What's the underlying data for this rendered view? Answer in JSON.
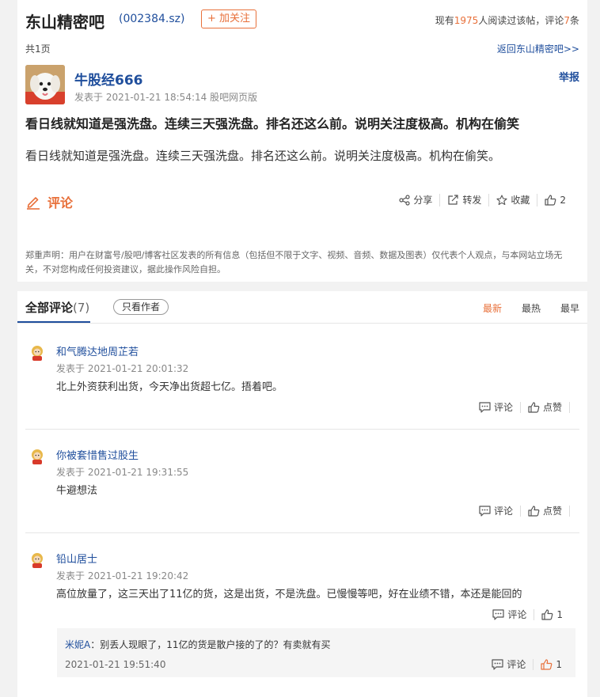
{
  "topbar": {
    "title": "东山精密吧",
    "stock_code": "(002384.sz)",
    "follow_label": "+ 加关注",
    "stats_prefix": "现有",
    "readers": "1975",
    "stats_mid": "人阅读过该帖，评论",
    "comment_count": "7",
    "stats_suffix": "条"
  },
  "nav": {
    "page_count": "共1页",
    "back_link": "返回东山精密吧>>"
  },
  "post": {
    "author": "牛股经666",
    "meta": "发表于 2021-01-21 18:54:14 股吧网页版",
    "report_label": "举报",
    "title": "看日线就知道是强洗盘。连续三天强洗盘。排名还这么前。说明关注度极高。机构在偷笑",
    "body": "看日线就知道是强洗盘。连续三天强洗盘。排名还这么前。说明关注度极高。机构在偷笑。",
    "comment_label": "评论",
    "actions": {
      "share": "分享",
      "repost": "转发",
      "collect": "收藏",
      "likes": "2"
    }
  },
  "disclaimer": "郑重声明：用户在财富号/股吧/博客社区发表的所有信息（包括但不限于文字、视频、音频、数据及图表）仅代表个人观点，与本网站立场无关，不对您构成任何投资建议，据此操作风险自担。",
  "comments_header": {
    "all_label": "全部评论",
    "count": "(7)",
    "author_only": "只看作者",
    "sort_latest": "最新",
    "sort_hot": "最热",
    "sort_earliest": "最早"
  },
  "comments": [
    {
      "name": "和气腾达地周芷若",
      "time": "发表于 2021-01-21 20:01:32",
      "text": "北上外资获利出货，今天净出货超七亿。捂着吧。",
      "reply_label": "评论",
      "like_label": "点赞"
    },
    {
      "name": "你被套惜售过股生",
      "time": "发表于 2021-01-21 19:31:55",
      "text": "牛避想法",
      "reply_label": "评论",
      "like_label": "点赞"
    },
    {
      "name": "铅山居士",
      "time": "发表于 2021-01-21 19:20:42",
      "text": "高位放量了，这三天出了11亿的货，这是出货，不是洗盘。已慢慢等吧，好在业绩不错，本还是能回的",
      "reply_label": "评论",
      "like_count": "1",
      "reply": {
        "name": "米妮A",
        "text": "：别丢人现眼了，11亿的货是散户接的了的？有卖就有买",
        "time": "2021-01-21 19:51:40",
        "reply_label": "评论",
        "like_count": "1"
      }
    }
  ],
  "colors": {
    "accent": "#e8703a",
    "link": "#1f4e9c",
    "background": "#f2f2f2"
  }
}
